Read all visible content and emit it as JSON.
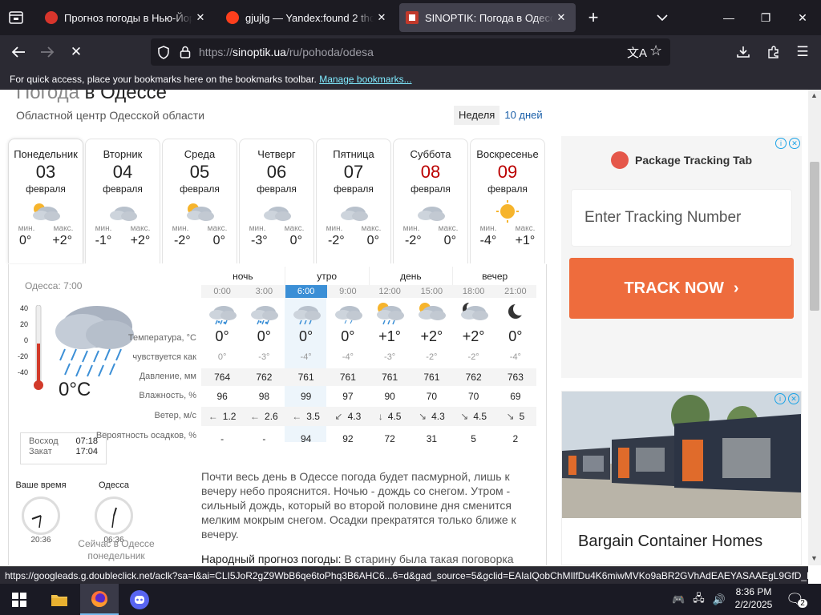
{
  "browser": {
    "tabs": [
      {
        "title": "Прогноз погоды в Нью-Йорке",
        "favicon_color": "#d7352c"
      },
      {
        "title": "gjujlg — Yandex:found 2 thousand results",
        "favicon_color": "#fc3f1d"
      },
      {
        "title": "SINOPTIK: Погода в Одессе. Прогноз",
        "favicon_color": "#c0392b"
      }
    ],
    "url_prefix": "https://",
    "url_host": "sinoptik.ua",
    "url_path": "/ru/pohoda/odesa",
    "bookmarks_text": "For quick access, place your bookmarks here on the bookmarks toolbar.",
    "bookmarks_link": "Manage bookmarks..."
  },
  "page": {
    "title_light": "Погода",
    "title_main": "в Одессе",
    "subtitle": "Областной центр Одесской области",
    "period_week": "Неделя",
    "period_10": "10 дней"
  },
  "days": [
    {
      "name": "Понедельник",
      "date": "03",
      "month": "февраля",
      "icon": "sun-cloud-icon",
      "min_label": "мин.",
      "max_label": "макс.",
      "min": "0°",
      "max": "+2°",
      "weekend": false
    },
    {
      "name": "Вторник",
      "date": "04",
      "month": "февраля",
      "icon": "cloud-icon",
      "min_label": "мин.",
      "max_label": "макс.",
      "min": "-1°",
      "max": "+2°",
      "weekend": false
    },
    {
      "name": "Среда",
      "date": "05",
      "month": "февраля",
      "icon": "sun-cloud-icon",
      "min_label": "мин.",
      "max_label": "макс.",
      "min": "-2°",
      "max": "0°",
      "weekend": false
    },
    {
      "name": "Четверг",
      "date": "06",
      "month": "февраля",
      "icon": "cloud-icon",
      "min_label": "мин.",
      "max_label": "макс.",
      "min": "-3°",
      "max": "0°",
      "weekend": false
    },
    {
      "name": "Пятница",
      "date": "07",
      "month": "февраля",
      "icon": "cloud-icon",
      "min_label": "мин.",
      "max_label": "макс.",
      "min": "-2°",
      "max": "0°",
      "weekend": false
    },
    {
      "name": "Суббота",
      "date": "08",
      "month": "февраля",
      "icon": "cloud-icon",
      "min_label": "мин.",
      "max_label": "макс.",
      "min": "-2°",
      "max": "0°",
      "weekend": true
    },
    {
      "name": "Воскресенье",
      "date": "09",
      "month": "февраля",
      "icon": "sun-icon",
      "min_label": "мин.",
      "max_label": "макс.",
      "min": "-4°",
      "max": "+1°",
      "weekend": true
    }
  ],
  "current": {
    "title": "Одесса: 7:00",
    "scale": [
      "40",
      "20",
      "0",
      "-20",
      "-40"
    ],
    "temp": "0°C",
    "sunrise_label": "Восход",
    "sunrise": "07:18",
    "sunset_label": "Закат",
    "sunset": "17:04",
    "your_time_label": "Ваше время",
    "your_time": "20:36",
    "city_label": "Одесса",
    "city_time": "06:36",
    "caption": "Сейчас в Одессе понедельник"
  },
  "hourly": {
    "parts": [
      "ночь",
      "утро",
      "день",
      "вечер"
    ],
    "hours": [
      "0:00",
      "3:00",
      "6:00",
      "9:00",
      "12:00",
      "15:00",
      "18:00",
      "21:00"
    ],
    "icons": [
      "cloud-rain-snow-icon",
      "cloud-rain-snow-icon",
      "cloud-rain-icon",
      "cloud-light-rain-icon",
      "sun-cloud-rain-icon",
      "sun-cloud-icon",
      "moon-cloud-icon",
      "moon-icon"
    ],
    "labels": {
      "temperature": "Температура, °C",
      "feels": "чувствуется как",
      "pressure": "Давление, мм",
      "humidity": "Влажность, %",
      "wind": "Ветер, м/с",
      "precip": "Вероятность осадков, %"
    },
    "temperature": [
      "0°",
      "0°",
      "0°",
      "0°",
      "+1°",
      "+2°",
      "+2°",
      "0°"
    ],
    "feels": [
      "0°",
      "-3°",
      "-4°",
      "-4°",
      "-3°",
      "-2°",
      "-2°",
      "-4°"
    ],
    "pressure": [
      "764",
      "762",
      "761",
      "761",
      "761",
      "761",
      "762",
      "763"
    ],
    "humidity": [
      "96",
      "98",
      "99",
      "97",
      "90",
      "70",
      "70",
      "69"
    ],
    "wind_dir": [
      "←",
      "←",
      "←",
      "↙",
      "↓",
      "↘",
      "↘",
      "↘"
    ],
    "wind": [
      "1.2",
      "2.6",
      "3.5",
      "4.3",
      "4.5",
      "4.3",
      "4.5",
      "5"
    ],
    "precip": [
      "-",
      "-",
      "94",
      "92",
      "72",
      "31",
      "5",
      "2"
    ]
  },
  "description": "Почти весь день в Одессе погода будет пасмурной, лишь к вечеру небо прояснится. Ночью - дождь со снегом. Утром - сильный дождь, который во второй половине дня сменится мелким мокрым снегом. Осадки прекратятся только ближе к вечеру.",
  "folk_label": "Народный прогноз погоды:",
  "folk_text": "В старину была такая поговорка",
  "ads": {
    "ad1_title": "Package Tracking Tab",
    "ad1_input": "Enter Tracking Number",
    "ad1_button": "TRACK NOW",
    "ad2_caption": "Bargain Container Homes"
  },
  "status_url": "https://googleads.g.doubleclick.net/aclk?sa=l&ai=CLI5JoR2gZ9WbB6qe6toPhq3B6AHC6...6=d&gad_source=5&gclid=EAIaIQobChMIlfDu4K6miwMVKo9aBR2GVhAdEAEYASAAEgL9GfD_BwE",
  "taskbar": {
    "time": "8:36 PM",
    "date": "2/2/2025",
    "notifications": "2"
  },
  "colors": {
    "accent": "#3b8fd6",
    "weekend": "#bb0000",
    "ad_button": "#ee6c3d"
  }
}
